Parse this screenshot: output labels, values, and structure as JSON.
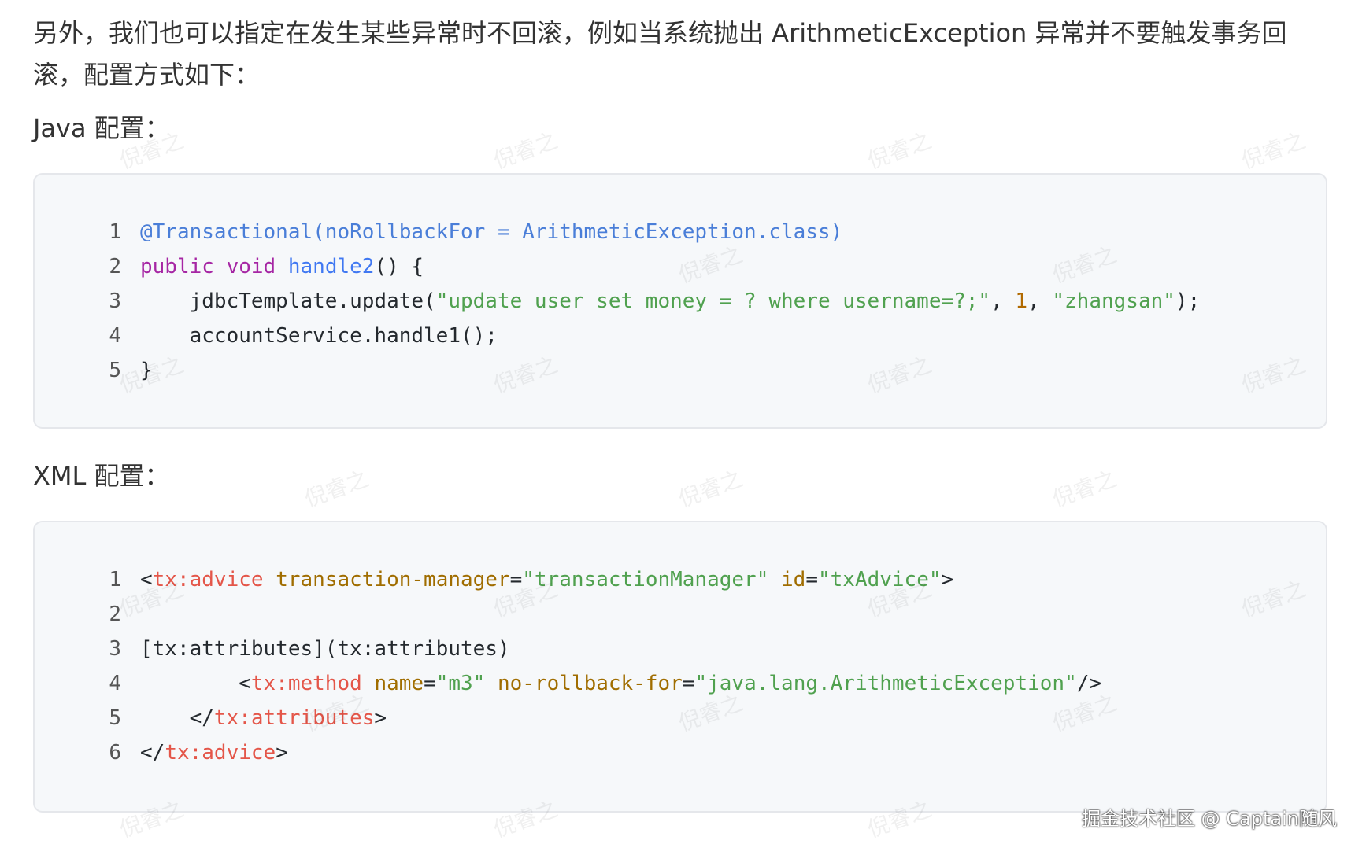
{
  "intro": "另外，我们也可以指定在发生某些异常时不回滚，例如当系统抛出 ArithmeticException 异常并不要触发事务回滚，配置方式如下：",
  "java_label": "Java 配置：",
  "xml_label": "XML 配置：",
  "java_code": {
    "line_numbers": [
      "1",
      "2",
      "3",
      "4",
      "5"
    ],
    "l1": "@Transactional(noRollbackFor = ArithmeticException.class)",
    "l2_kw1": "public",
    "l2_kw2": "void",
    "l2_fn": "handle2",
    "l2_rest": "() {",
    "l3_a": "    jdbcTemplate.update(",
    "l3_str1": "\"update user set money = ? where username=?;\"",
    "l3_b": ", ",
    "l3_num": "1",
    "l3_c": ", ",
    "l3_str2": "\"zhangsan\"",
    "l3_d": ");",
    "l4": "    accountService.handle1();",
    "l5": "}"
  },
  "xml_code": {
    "line_numbers": [
      "1",
      "2",
      "3",
      "4",
      "5",
      "6"
    ],
    "l1_open": "<",
    "l1_tag": "tx:advice",
    "l1_attr1": "transaction-manager",
    "l1_eq1": "=",
    "l1_val1": "\"transactionManager\"",
    "l1_attr2": "id",
    "l1_eq2": "=",
    "l1_val2": "\"txAdvice\"",
    "l1_close": ">",
    "l3": "[tx:attributes](tx:attributes)",
    "l4_open": "        <",
    "l4_tag": "tx:method",
    "l4_attr1": "name",
    "l4_eq1": "=",
    "l4_val1": "\"m3\"",
    "l4_attr2": "no-rollback-for",
    "l4_eq2": "=",
    "l4_val2": "\"java.lang.ArithmeticException\"",
    "l4_close": "/>",
    "l5_open": "    </",
    "l5_tag": "tx:attributes",
    "l5_close": ">",
    "l6_open": "</",
    "l6_tag": "tx:advice",
    "l6_close": ">"
  },
  "watermark": "倪睿之",
  "credit": "掘金技术社区 @ Captain随风"
}
